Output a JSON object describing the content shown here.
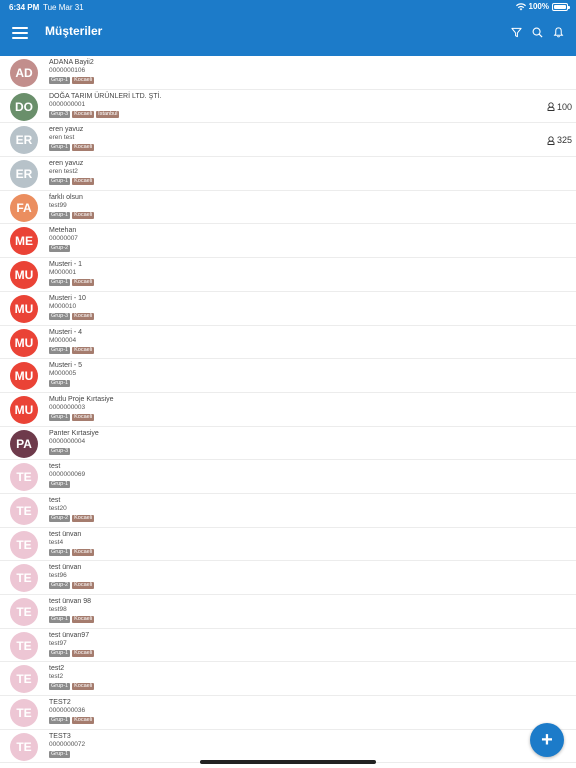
{
  "status": {
    "time": "6:34 PM",
    "date": "Tue Mar 31",
    "battery": "100%"
  },
  "header": {
    "title": "Müşteriler"
  },
  "colors": {
    "brand": "#1c7bc9"
  },
  "customers": [
    {
      "initials": "AD",
      "color": "#c28e8c",
      "name": "ADANA Bayii2",
      "code": "0000000106",
      "tags": [
        "Grup-1",
        "Kocaeli"
      ],
      "badge": ""
    },
    {
      "initials": "DO",
      "color": "#6a8f6b",
      "name": "DOĞA TARIM ÜRÜNLERİ LTD. ŞTİ.",
      "code": "0000000001",
      "tags": [
        "Grup-3",
        "Kocaeli",
        "İstanbul"
      ],
      "badge": "100"
    },
    {
      "initials": "ER",
      "color": "#b7c2c9",
      "name": "eren yavuz",
      "code": "eren test",
      "tags": [
        "Grup-1",
        "Kocaeli"
      ],
      "badge": "325"
    },
    {
      "initials": "ER",
      "color": "#b7c2c9",
      "name": "eren yavuz",
      "code": "eren test2",
      "tags": [
        "Grup-1",
        "Kocaeli"
      ],
      "badge": ""
    },
    {
      "initials": "FA",
      "color": "#eb8e5f",
      "name": "farklı olsun",
      "code": "test99",
      "tags": [
        "Grup-1",
        "Kocaeli"
      ],
      "badge": ""
    },
    {
      "initials": "ME",
      "color": "#ea4336",
      "name": "Metehan",
      "code": "00000007",
      "tags": [
        "Grup-2"
      ],
      "badge": ""
    },
    {
      "initials": "MU",
      "color": "#ea4336",
      "name": "Musteri - 1",
      "code": "M000001",
      "tags": [
        "Grup-1",
        "Kocaeli"
      ],
      "badge": ""
    },
    {
      "initials": "MU",
      "color": "#ea4336",
      "name": "Musteri - 10",
      "code": "M000010",
      "tags": [
        "Grup-3",
        "Kocaeli"
      ],
      "badge": ""
    },
    {
      "initials": "MU",
      "color": "#ea4336",
      "name": "Musteri - 4",
      "code": "M000004",
      "tags": [
        "Grup-1",
        "Kocaeli"
      ],
      "badge": ""
    },
    {
      "initials": "MU",
      "color": "#ea4336",
      "name": "Musteri - 5",
      "code": "M000005",
      "tags": [
        "Grup-1"
      ],
      "badge": ""
    },
    {
      "initials": "MU",
      "color": "#ea4336",
      "name": "Mutlu Proje Kırtasiye",
      "code": "0000000003",
      "tags": [
        "Grup-1",
        "Kocaeli"
      ],
      "badge": ""
    },
    {
      "initials": "PA",
      "color": "#6e3a4b",
      "name": "Panter Kırtasiye",
      "code": "0000000004",
      "tags": [
        "Grup-3"
      ],
      "badge": ""
    },
    {
      "initials": "TE",
      "color": "#edc6d4",
      "name": "test",
      "code": "0000000069",
      "tags": [
        "Grup-1"
      ],
      "badge": ""
    },
    {
      "initials": "TE",
      "color": "#edc6d4",
      "name": "test",
      "code": "test20",
      "tags": [
        "Grup-2",
        "Kocaeli"
      ],
      "badge": ""
    },
    {
      "initials": "TE",
      "color": "#edc6d4",
      "name": "test ünvan",
      "code": "test4",
      "tags": [
        "Grup-1",
        "Kocaeli"
      ],
      "badge": ""
    },
    {
      "initials": "TE",
      "color": "#edc6d4",
      "name": "test ünvan",
      "code": "test96",
      "tags": [
        "Grup-2",
        "Kocaeli"
      ],
      "badge": ""
    },
    {
      "initials": "TE",
      "color": "#edc6d4",
      "name": "test ünvan 98",
      "code": "test98",
      "tags": [
        "Grup-1",
        "Kocaeli"
      ],
      "badge": ""
    },
    {
      "initials": "TE",
      "color": "#edc6d4",
      "name": "test ünvan97",
      "code": "test97",
      "tags": [
        "Grup-1",
        "Kocaeli"
      ],
      "badge": ""
    },
    {
      "initials": "TE",
      "color": "#edc6d4",
      "name": "test2",
      "code": "test2",
      "tags": [
        "Grup-1",
        "Kocaeli"
      ],
      "badge": ""
    },
    {
      "initials": "TE",
      "color": "#edc6d4",
      "name": "TEST2",
      "code": "0000000036",
      "tags": [
        "Grup-1",
        "Kocaeli"
      ],
      "badge": ""
    },
    {
      "initials": "TE",
      "color": "#edc6d4",
      "name": "TEST3",
      "code": "0000000072",
      "tags": [
        "Grup-1"
      ],
      "badge": ""
    }
  ],
  "fab": {
    "label": "+"
  }
}
